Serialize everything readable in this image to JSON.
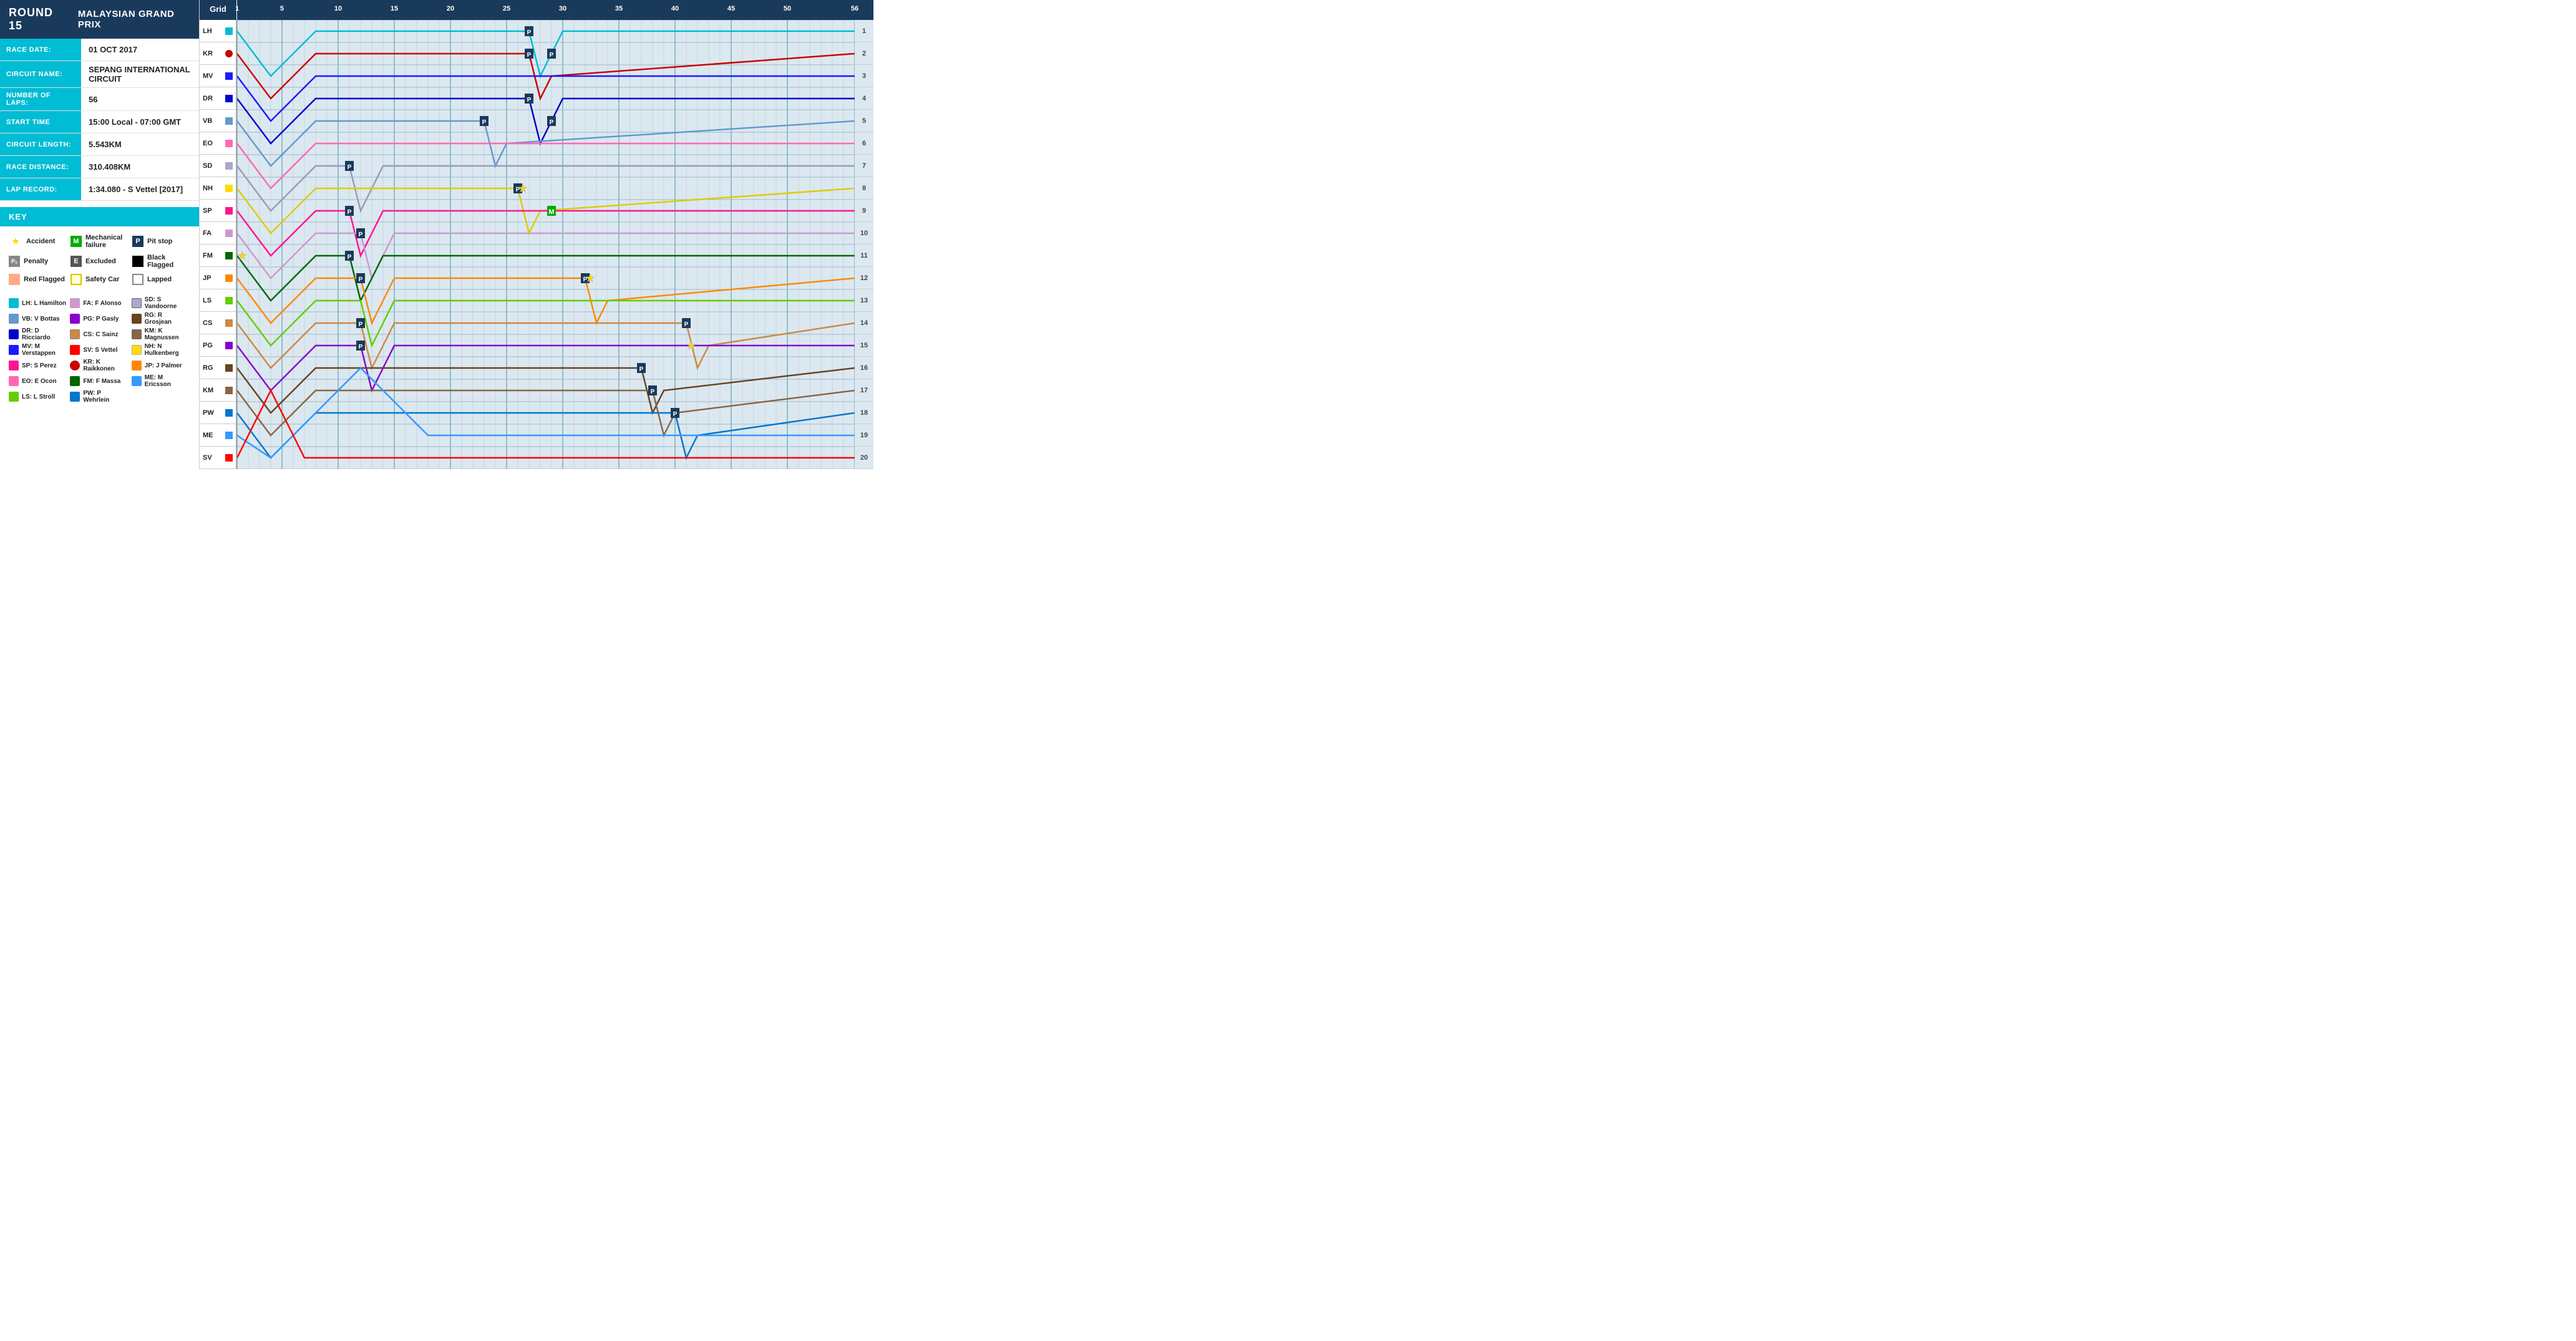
{
  "header": {
    "round": "ROUND 15",
    "race_name": "MALAYSIAN GRAND PRIX"
  },
  "info": {
    "race_date_label": "RACE DATE:",
    "race_date_value": "01 OCT 2017",
    "circuit_name_label": "CIRCUIT NAME:",
    "circuit_name_value": "SEPANG INTERNATIONAL CIRCUIT",
    "number_of_laps_label": "NUMBER OF LAPS:",
    "number_of_laps_value": "56",
    "start_time_label": "START TIME",
    "start_time_value": "15:00 Local - 07:00 GMT",
    "circuit_length_label": "CIRCUIT LENGTH:",
    "circuit_length_value": "5.543KM",
    "race_distance_label": "RACE DISTANCE:",
    "race_distance_value": "310.408KM",
    "lap_record_label": "LAP RECORD:",
    "lap_record_value": "1:34.080 - S Vettel [2017]"
  },
  "key": {
    "header": "KEY",
    "symbols": [
      {
        "symbol": "★",
        "label": "Accident"
      },
      {
        "symbol": "M",
        "label": "Mechanical failure"
      },
      {
        "symbol": "P",
        "label": "Pit stop"
      },
      {
        "symbol": "P₀",
        "label": "Penalty"
      },
      {
        "symbol": "E",
        "label": "Excluded"
      },
      {
        "symbol": "⬛",
        "label": "Black Flagged"
      },
      {
        "symbol": "🟧",
        "label": "Red Flagged"
      },
      {
        "symbol": "🟨",
        "label": "Safety Car"
      },
      {
        "symbol": "⬜",
        "label": "Lapped"
      }
    ]
  },
  "drivers": [
    {
      "abbr": "LH",
      "name": "L Hamilton",
      "color": "#00bcd4",
      "grid": 1
    },
    {
      "abbr": "KR",
      "name": "K Raikkonen",
      "color": "#cc0000",
      "grid": 2
    },
    {
      "abbr": "MV",
      "name": "M Verstappen",
      "color": "#1a1aff",
      "grid": 3
    },
    {
      "abbr": "DR",
      "name": "D Ricciardo",
      "color": "#0000cc",
      "grid": 4
    },
    {
      "abbr": "VB",
      "name": "V Bottas",
      "color": "#6699cc",
      "grid": 5
    },
    {
      "abbr": "EO",
      "name": "E Ocon",
      "color": "#ff69b4",
      "grid": 6
    },
    {
      "abbr": "SD",
      "name": "S Vandoorne",
      "color": "#aaaacc",
      "grid": 7
    },
    {
      "abbr": "NH",
      "name": "N Hulkenberg",
      "color": "#ffdd00",
      "grid": 8
    },
    {
      "abbr": "SP",
      "name": "S Perez",
      "color": "#ff1493",
      "grid": 9
    },
    {
      "abbr": "FA",
      "name": "F Alonso",
      "color": "#cc99cc",
      "grid": 10
    },
    {
      "abbr": "FM",
      "name": "F Massa",
      "color": "#006600",
      "grid": 11
    },
    {
      "abbr": "JP",
      "name": "J Palmer",
      "color": "#ff8800",
      "grid": 12
    },
    {
      "abbr": "LS",
      "name": "L Stroll",
      "color": "#66cc00",
      "grid": 13
    },
    {
      "abbr": "CS",
      "name": "C Sainz",
      "color": "#cc8844",
      "grid": 14
    },
    {
      "abbr": "PG",
      "name": "P Gasly",
      "color": "#8800cc",
      "grid": 15
    },
    {
      "abbr": "RG",
      "name": "R Grosjean",
      "color": "#664422",
      "grid": 16
    },
    {
      "abbr": "KM",
      "name": "K Magnussen",
      "color": "#886644",
      "grid": 17
    },
    {
      "abbr": "PW",
      "name": "P Wehrlein",
      "color": "#0077cc",
      "grid": 18
    },
    {
      "abbr": "ME",
      "name": "M Ericsson",
      "color": "#3399ff",
      "grid": 19
    },
    {
      "abbr": "SV",
      "name": "S Vettel",
      "color": "#ff0000",
      "grid": 20
    }
  ],
  "chart": {
    "grid_label": "Grid",
    "total_laps": 56,
    "lap_markers": [
      1,
      5,
      10,
      15,
      20,
      25,
      30,
      35,
      40,
      45,
      50,
      56
    ]
  }
}
